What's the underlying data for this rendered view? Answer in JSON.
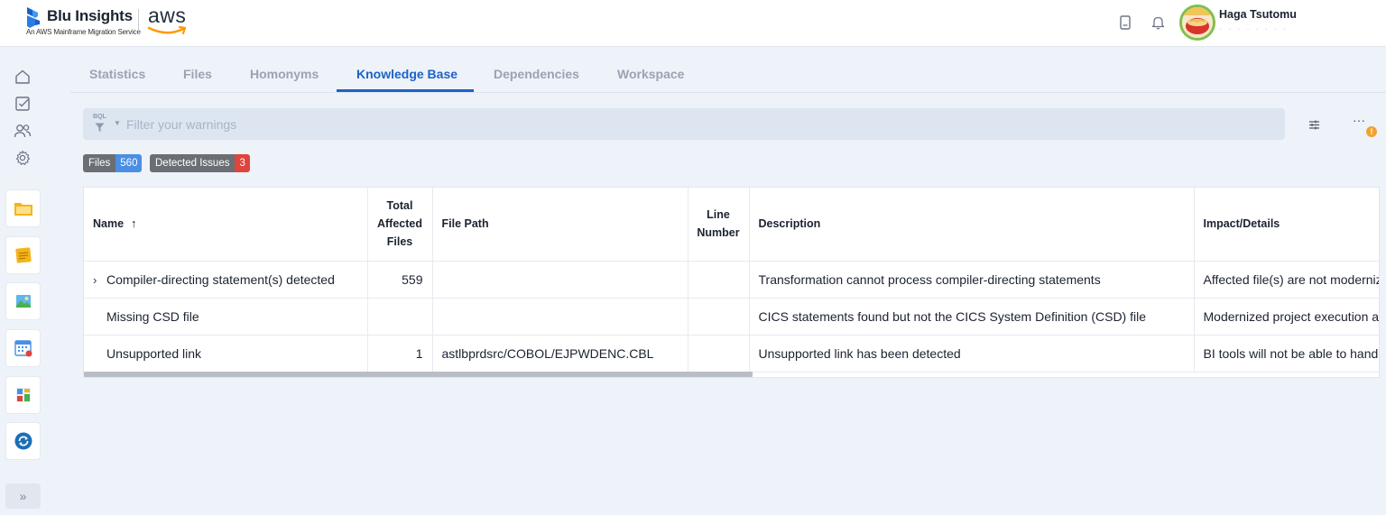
{
  "header": {
    "brand": "Blu Insights",
    "tagline": "An AWS Mainframe Migration Service",
    "partner_logo": "aws",
    "icons": [
      "book-icon",
      "bell-icon"
    ],
    "user": {
      "name": "Haga Tsutomu"
    }
  },
  "rail": {
    "nav_icons": [
      "home-icon",
      "tasks-icon",
      "users-icon",
      "settings-icon"
    ],
    "apps": [
      "folder-app-icon",
      "notes-app-icon",
      "gallery-app-icon",
      "calendar-app-icon",
      "dashboard-app-icon",
      "sync-app-icon"
    ],
    "toggle_label": "»"
  },
  "tabs": [
    {
      "label": "Statistics",
      "active": false
    },
    {
      "label": "Files",
      "active": false
    },
    {
      "label": "Homonyms",
      "active": false
    },
    {
      "label": "Knowledge Base",
      "active": true
    },
    {
      "label": "Dependencies",
      "active": false
    },
    {
      "label": "Workspace",
      "active": false
    }
  ],
  "filter": {
    "prefix": "BQL",
    "placeholder": "Filter your warnings",
    "value": "",
    "more_label": "···",
    "warning_mark": "!"
  },
  "badges": {
    "files": {
      "label": "Files",
      "count": "560"
    },
    "issues": {
      "label": "Detected Issues",
      "count": "3"
    }
  },
  "table": {
    "columns": {
      "name": "Name",
      "total_line1": "Total",
      "total_line2": "Affected",
      "total_line3": "Files",
      "file_path": "File Path",
      "line_line1": "Line",
      "line_line2": "Number",
      "description": "Description",
      "impact": "Impact/Details"
    },
    "sort_indicator": "↑",
    "rows": [
      {
        "expandable": true,
        "name": "Compiler-directing statement(s) detected",
        "total": "559",
        "file_path": "",
        "line": "",
        "description": "Transformation cannot process compiler-directing statements",
        "impact": "Affected file(s) are not modernized"
      },
      {
        "expandable": false,
        "name": "Missing CSD file",
        "total": "",
        "file_path": "",
        "line": "",
        "description": "CICS statements found but not the CICS System Definition (CSD) file",
        "impact": "Modernized project execution at runtime"
      },
      {
        "expandable": false,
        "name": "Unsupported link",
        "total": "1",
        "file_path": "astlbprdsrc/COBOL/EJPWDENC.CBL",
        "line": "",
        "description": "Unsupported link has been detected",
        "impact": "BI tools will not be able to handle"
      }
    ]
  },
  "colors": {
    "accent": "#1c63c6",
    "background": "#eef2f9",
    "badge_blue": "#4a8fe3",
    "badge_red": "#e0443c",
    "warning": "#f2a230"
  }
}
